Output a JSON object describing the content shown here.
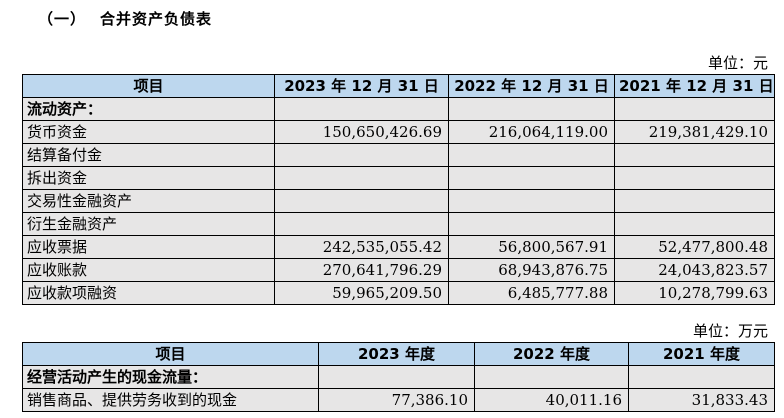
{
  "section": {
    "number": "（一）",
    "title": "合并资产负债表"
  },
  "balance_sheet": {
    "unit": "单位：元",
    "headers": [
      "项目",
      "2023 年 12 月 31 日",
      "2022 年 12 月 31 日",
      "2021 年 12 月 31 日"
    ],
    "rows": [
      [
        "流动资产：",
        "",
        "",
        ""
      ],
      [
        "货币资金",
        "150,650,426.69",
        "216,064,119.00",
        "219,381,429.10"
      ],
      [
        "结算备付金",
        "",
        "",
        ""
      ],
      [
        "拆出资金",
        "",
        "",
        ""
      ],
      [
        "交易性金融资产",
        "",
        "",
        ""
      ],
      [
        "衍生金融资产",
        "",
        "",
        ""
      ],
      [
        "应收票据",
        "242,535,055.42",
        "56,800,567.91",
        "52,477,800.48"
      ],
      [
        "应收账款",
        "270,641,796.29",
        "68,943,876.75",
        "24,043,823.57"
      ],
      [
        "应收款项融资",
        "59,965,209.50",
        "6,485,777.88",
        "10,278,799.63"
      ]
    ]
  },
  "cash_flow": {
    "unit": "单位：万元",
    "headers": [
      "项目",
      "2023 年度",
      "2022 年度",
      "2021 年度"
    ],
    "rows": [
      [
        "经营活动产生的现金流量：",
        "",
        "",
        ""
      ],
      [
        "销售商品、提供劳务收到的现金",
        "77,386.10",
        "40,011.16",
        "31,833.43"
      ]
    ]
  }
}
